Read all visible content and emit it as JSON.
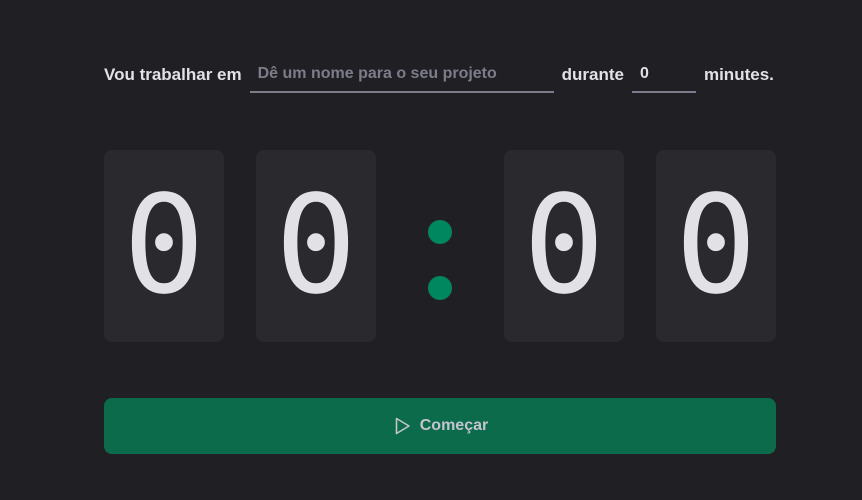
{
  "form": {
    "label_working_on": "Vou trabalhar em",
    "task_placeholder": "Dê um nome para o seu projeto",
    "task_value": "",
    "label_during": "durante",
    "minutes_value": "0",
    "label_minutes": "minutes."
  },
  "countdown": {
    "minutes_tens": "0",
    "minutes_ones": "0",
    "seconds_tens": "0",
    "seconds_ones": "0"
  },
  "start_button": {
    "label": "Começar",
    "icon": "play-icon"
  },
  "colors": {
    "background": "#202024",
    "card": "#29292e",
    "text": "#e1e1e6",
    "placeholder": "#7c7c8a",
    "accent": "#00875f",
    "button": "#0b6b4b"
  }
}
